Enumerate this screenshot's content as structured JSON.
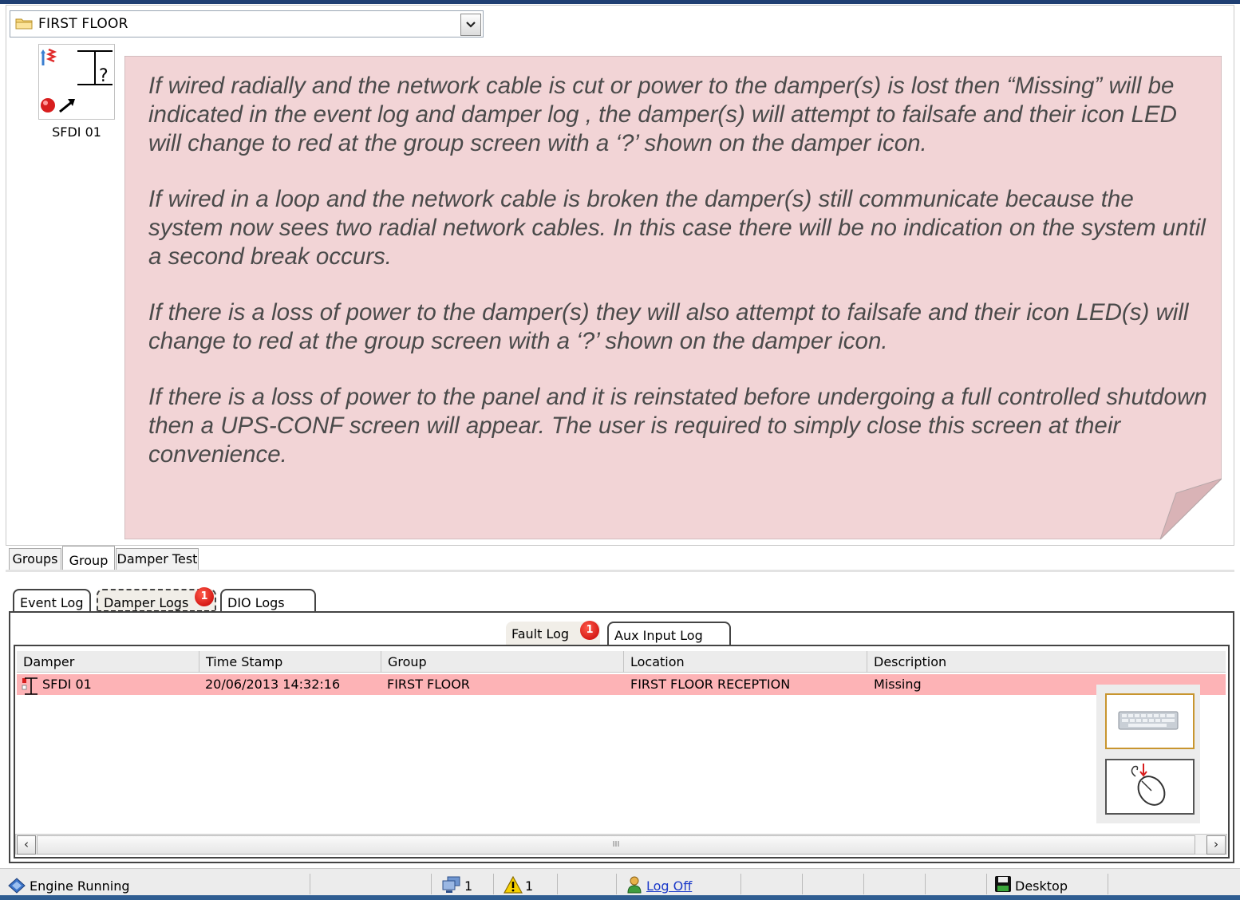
{
  "location_selector": {
    "value": "FIRST FLOOR"
  },
  "damper_tile": {
    "name": "SFDI 01"
  },
  "note": {
    "paragraphs": [
      "If wired radially and the network cable is cut or power to the damper(s) is lost then “Missing” will be indicated in the event log and damper log , the damper(s) will attempt to failsafe and their icon LED will change to red at the group screen with a ‘?’ shown on the damper icon.",
      "If wired in a loop and the network cable is broken the damper(s) still communicate because the system now sees two radial network cables. In this case there will be no indication on the system until a second break occurs.",
      "If there is a loss of power to the damper(s) they will also attempt to failsafe and their icon LED(s) will change to red at the group screen with a ‘?’ shown on the damper icon.",
      "If there is a loss of power to the panel and it is reinstated before undergoing a full controlled shutdown then a UPS-CONF screen will appear. The user is required to simply close this screen at their convenience."
    ]
  },
  "view_tabs": [
    "Groups",
    "Group",
    "Damper Test"
  ],
  "log_tabs": {
    "event": "Event Log",
    "damper": "Damper Logs",
    "damper_badge": "1",
    "dio": "DIO Logs"
  },
  "sub_tabs": {
    "fault": "Fault Log",
    "fault_badge": "1",
    "aux": "Aux Input Log"
  },
  "table": {
    "columns": [
      "Damper",
      "Time Stamp",
      "Group",
      "Location",
      "Description"
    ],
    "rows": [
      [
        "SFDI 01",
        "20/06/2013 14:32:16",
        "FIRST FLOOR",
        "FIRST FLOOR RECEPTION",
        "Missing"
      ]
    ]
  },
  "scrollbar": {
    "grip": "III"
  },
  "status_bar": {
    "engine": "Engine Running",
    "network_count": "1",
    "warning_count": "1",
    "logoff": "Log Off",
    "desktop": "Desktop"
  },
  "colors": {
    "fault_row": "#fdb3b6",
    "note_bg": "#f2d4d6",
    "status_bottom": "#2f5d91"
  }
}
